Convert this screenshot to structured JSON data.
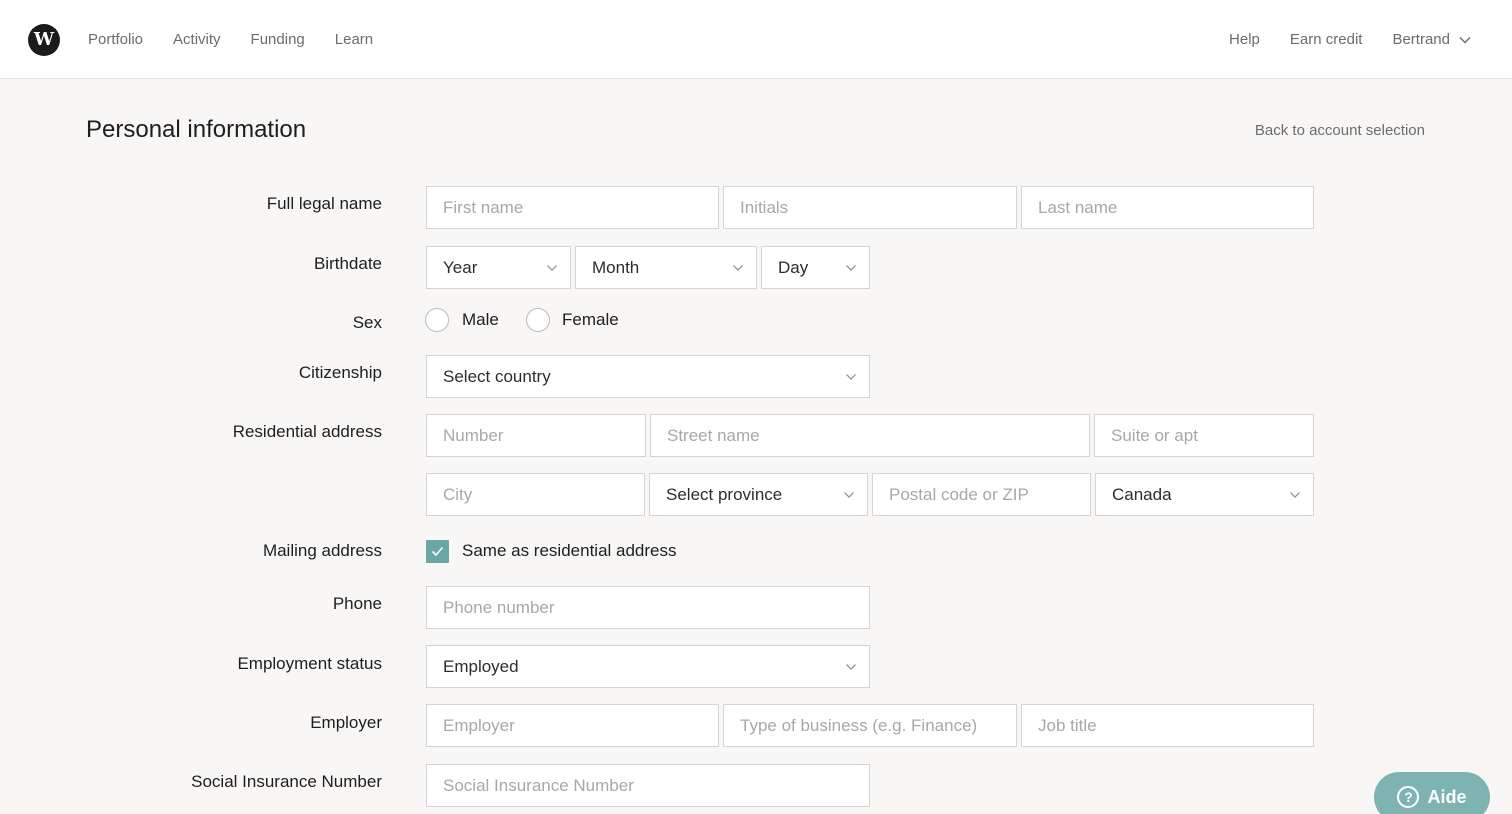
{
  "nav": {
    "logo_letter": "W",
    "left_items": [
      "Portfolio",
      "Activity",
      "Funding",
      "Learn"
    ],
    "help": "Help",
    "earn_credit": "Earn credit",
    "user_name": "Bertrand"
  },
  "page": {
    "title": "Personal information",
    "back_link": "Back to account selection"
  },
  "form": {
    "full_legal_name": {
      "label": "Full legal name",
      "first_placeholder": "First name",
      "initials_placeholder": "Initials",
      "last_placeholder": "Last name"
    },
    "birthdate": {
      "label": "Birthdate",
      "year": "Year",
      "month": "Month",
      "day": "Day"
    },
    "sex": {
      "label": "Sex",
      "male": "Male",
      "female": "Female"
    },
    "citizenship": {
      "label": "Citizenship",
      "value": "Select country"
    },
    "residential_address": {
      "label": "Residential address",
      "number_placeholder": "Number",
      "street_placeholder": "Street name",
      "suite_placeholder": "Suite or apt",
      "city_placeholder": "City",
      "province_value": "Select province",
      "postal_placeholder": "Postal code or ZIP",
      "country_value": "Canada"
    },
    "mailing_address": {
      "label": "Mailing address",
      "same_as_label": "Same as residential address",
      "same_as_checked": true
    },
    "phone": {
      "label": "Phone",
      "placeholder": "Phone number"
    },
    "employment_status": {
      "label": "Employment status",
      "value": "Employed"
    },
    "employer": {
      "label": "Employer",
      "employer_placeholder": "Employer",
      "business_placeholder": "Type of business (e.g. Finance)",
      "job_placeholder": "Job title"
    },
    "sin": {
      "label": "Social Insurance Number",
      "placeholder": "Social Insurance Number"
    }
  },
  "help_widget": {
    "label": "Aide",
    "accent_color": "#7fb3b1"
  },
  "colors": {
    "checkbox_accent": "#6aa6a4",
    "background": "#f8f7f6"
  }
}
